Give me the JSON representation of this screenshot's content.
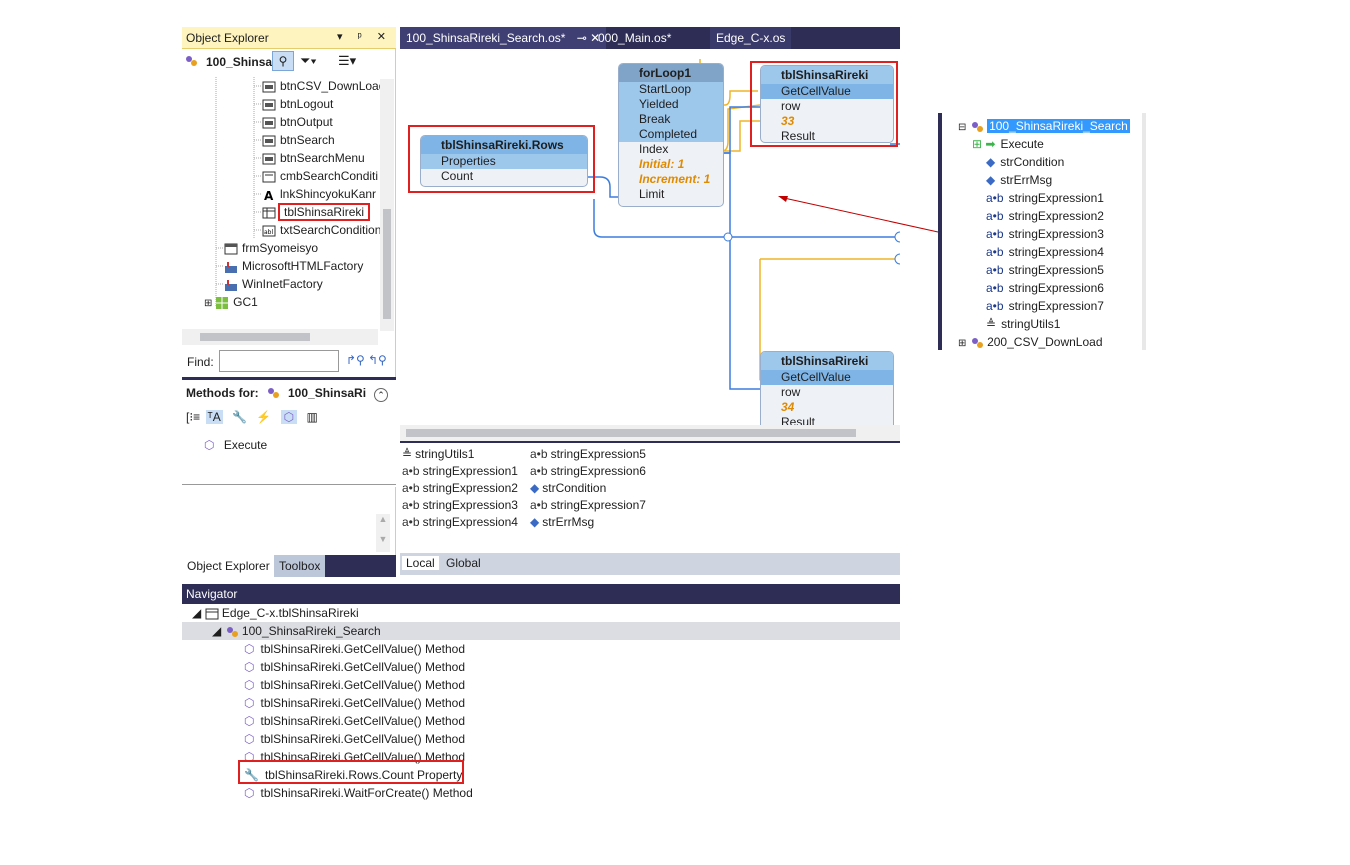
{
  "object_explorer": {
    "title": "Object Explorer",
    "title_buttons": "▼ ᵖ ✕",
    "root": "100_Shinsa",
    "items": [
      {
        "label": "btnCSV_DownLoad",
        "icon": "button-icon"
      },
      {
        "label": "btnLogout",
        "icon": "button-icon"
      },
      {
        "label": "btnOutput",
        "icon": "button-icon"
      },
      {
        "label": "btnSearch",
        "icon": "button-icon"
      },
      {
        "label": "btnSearchMenu",
        "icon": "button-icon"
      },
      {
        "label": "cmbSearchConditi",
        "icon": "combo-icon"
      },
      {
        "label": "lnkShincyokuKanr",
        "icon": "label-icon"
      },
      {
        "label": "tblShinsaRireki",
        "icon": "table-icon"
      },
      {
        "label": "txtSearchCondition",
        "icon": "textbox-icon"
      },
      {
        "label": "frmSyomeisyo",
        "icon": "form-icon"
      },
      {
        "label": "MicrosoftHTMLFactory",
        "icon": "factory-icon"
      },
      {
        "label": "WinInetFactory",
        "icon": "factory-icon"
      },
      {
        "label": "GC1",
        "icon": "grid-icon"
      }
    ],
    "find_label": "Find:",
    "bottom_tabs": [
      "Object Explorer",
      "Toolbox"
    ]
  },
  "methods": {
    "label": "Methods for:",
    "target": "100_ShinsaRi",
    "items": [
      "Execute"
    ]
  },
  "designer": {
    "tabs": [
      "100_ShinsaRireki_Search.os*",
      "000_Main.os*",
      "Edge_C-x.os"
    ],
    "rows_node": {
      "title": "tblShinsaRireki.Rows",
      "pins": [
        "Properties",
        "Count"
      ]
    },
    "loop_node": {
      "title": "forLoop1",
      "pins": [
        "StartLoop",
        "Yielded",
        "Break",
        "Completed",
        "Index",
        "Initial: 1",
        "Increment: 1",
        "Limit"
      ]
    },
    "cell_node_1": {
      "title": "tblShinsaRireki",
      "pins": [
        "GetCellValue",
        "row",
        "33",
        "Result"
      ]
    },
    "cell_node_2": {
      "title": "tblShinsaRireki",
      "pins": [
        "GetCellValue",
        "row",
        "34",
        "Result"
      ]
    }
  },
  "locals": {
    "items_col1": [
      "stringUtils1",
      "stringExpression1",
      "stringExpression2",
      "stringExpression3",
      "stringExpression4"
    ],
    "items_col2": [
      "stringExpression5",
      "stringExpression6",
      "strCondition",
      "stringExpression7",
      "strErrMsg"
    ],
    "tabs": [
      "Local",
      "Global"
    ]
  },
  "navigator": {
    "title": "Navigator",
    "root": "Edge_C-x.tblShinsaRireki",
    "child": "100_ShinsaRireki_Search",
    "items": [
      "tblShinsaRireki.GetCellValue() Method",
      "tblShinsaRireki.GetCellValue() Method",
      "tblShinsaRireki.GetCellValue() Method",
      "tblShinsaRireki.GetCellValue() Method",
      "tblShinsaRireki.GetCellValue() Method",
      "tblShinsaRireki.GetCellValue() Method",
      "tblShinsaRireki.GetCellValue() Method",
      "tblShinsaRireki.Rows.Count Property",
      "tblShinsaRireki.WaitForCreate() Method"
    ]
  },
  "right_tree": {
    "selected": "100_ShinsaRireki_Search",
    "items": [
      "Execute",
      "strCondition",
      "strErrMsg",
      "stringExpression1",
      "stringExpression2",
      "stringExpression3",
      "stringExpression4",
      "stringExpression5",
      "stringExpression6",
      "stringExpression7",
      "stringUtils1"
    ],
    "last": "200_CSV_DownLoad"
  }
}
